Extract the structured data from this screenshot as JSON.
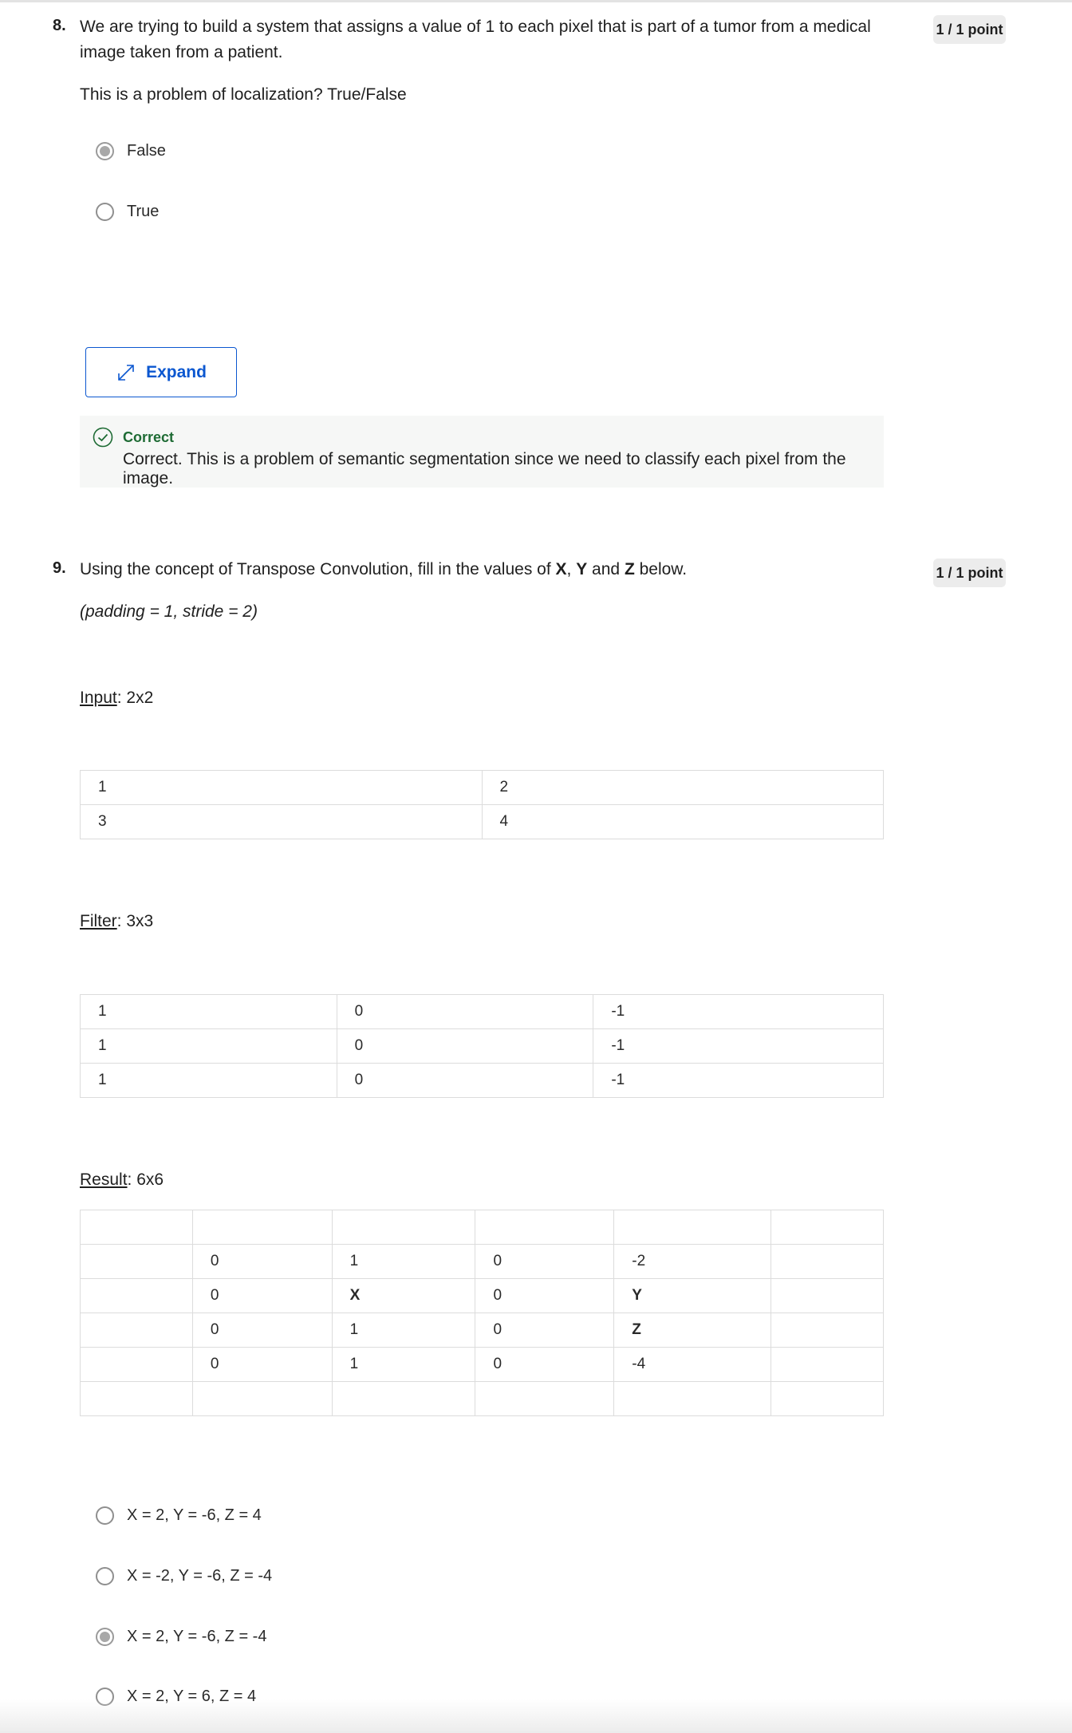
{
  "q8": {
    "number": "8.",
    "text": "We are trying to build a system that assigns a value of 1 to each pixel that is part of a tumor from a medical image taken from a patient.",
    "prompt": "This is a problem of localization? True/False",
    "points": "1 / 1 point",
    "options": [
      {
        "label": "False",
        "selected": true
      },
      {
        "label": "True",
        "selected": false
      }
    ],
    "expand_label": "Expand",
    "feedback": {
      "title": "Correct",
      "body": "Correct. This is a problem of semantic segmentation since we need to classify each pixel from the image."
    }
  },
  "q9": {
    "number": "9.",
    "text_pre": "Using the concept of Transpose Convolution, fill in the values of ",
    "x": "X",
    "sep1": ", ",
    "y": "Y",
    "sep2": " and ",
    "z": "Z",
    "text_post": " below.",
    "params": "(padding = 1, stride = 2)",
    "points": "1 / 1 point",
    "input_label": "Input",
    "input_size": ": 2x2",
    "input_rows": [
      [
        "1",
        "2"
      ],
      [
        "3",
        "4"
      ]
    ],
    "filter_label": "Filter",
    "filter_size": ": 3x3",
    "filter_rows": [
      [
        "1",
        "0",
        "-1"
      ],
      [
        "1",
        "0",
        "-1"
      ],
      [
        "1",
        "0",
        "-1"
      ]
    ],
    "result_label": "Result",
    "result_size": ": 6x6",
    "result_rows": [
      [
        "",
        "",
        "",
        "",
        "",
        ""
      ],
      [
        "",
        "0",
        "1",
        "0",
        "-2",
        ""
      ],
      [
        "",
        "0",
        "X",
        "0",
        "Y",
        ""
      ],
      [
        "",
        "0",
        "1",
        "0",
        "Z",
        ""
      ],
      [
        "",
        "0",
        "1",
        "0",
        "-4",
        ""
      ],
      [
        "",
        "",
        "",
        "",
        "",
        ""
      ]
    ],
    "options": [
      {
        "label": "X = 2, Y = -6, Z = 4",
        "selected": false
      },
      {
        "label": "X = -2, Y = -6, Z = -4",
        "selected": false
      },
      {
        "label": "X = 2, Y = -6, Z = -4",
        "selected": true
      },
      {
        "label": "X = 2, Y = 6, Z = 4",
        "selected": false
      }
    ]
  },
  "colors": {
    "accent": "#0b57d0",
    "correct": "#1e6b34",
    "feedback_bg": "#f6f7f6"
  }
}
